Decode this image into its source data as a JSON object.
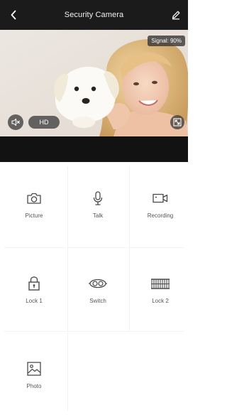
{
  "header": {
    "title": "Security Camera",
    "back_icon": "chevron-left-icon",
    "edit_icon": "pencil-icon"
  },
  "video": {
    "signal_label": "Signal: 90%",
    "hd_label": "HD",
    "mute_icon": "speaker-muted-icon",
    "fullscreen_icon": "fullscreen-icon"
  },
  "actions": [
    {
      "label": "Picture",
      "icon": "camera-icon"
    },
    {
      "label": "Talk",
      "icon": "microphone-icon"
    },
    {
      "label": "Recording",
      "icon": "video-camera-icon"
    },
    {
      "label": "Lock 1",
      "icon": "padlock-icon"
    },
    {
      "label": "Switch",
      "icon": "switch-icon"
    },
    {
      "label": "Lock 2",
      "icon": "gate-icon"
    },
    {
      "label": "Photo",
      "icon": "image-icon"
    }
  ],
  "colors": {
    "topbar": "#1b1b1b",
    "icon_stroke": "#4a4a4a",
    "label": "#555555"
  }
}
